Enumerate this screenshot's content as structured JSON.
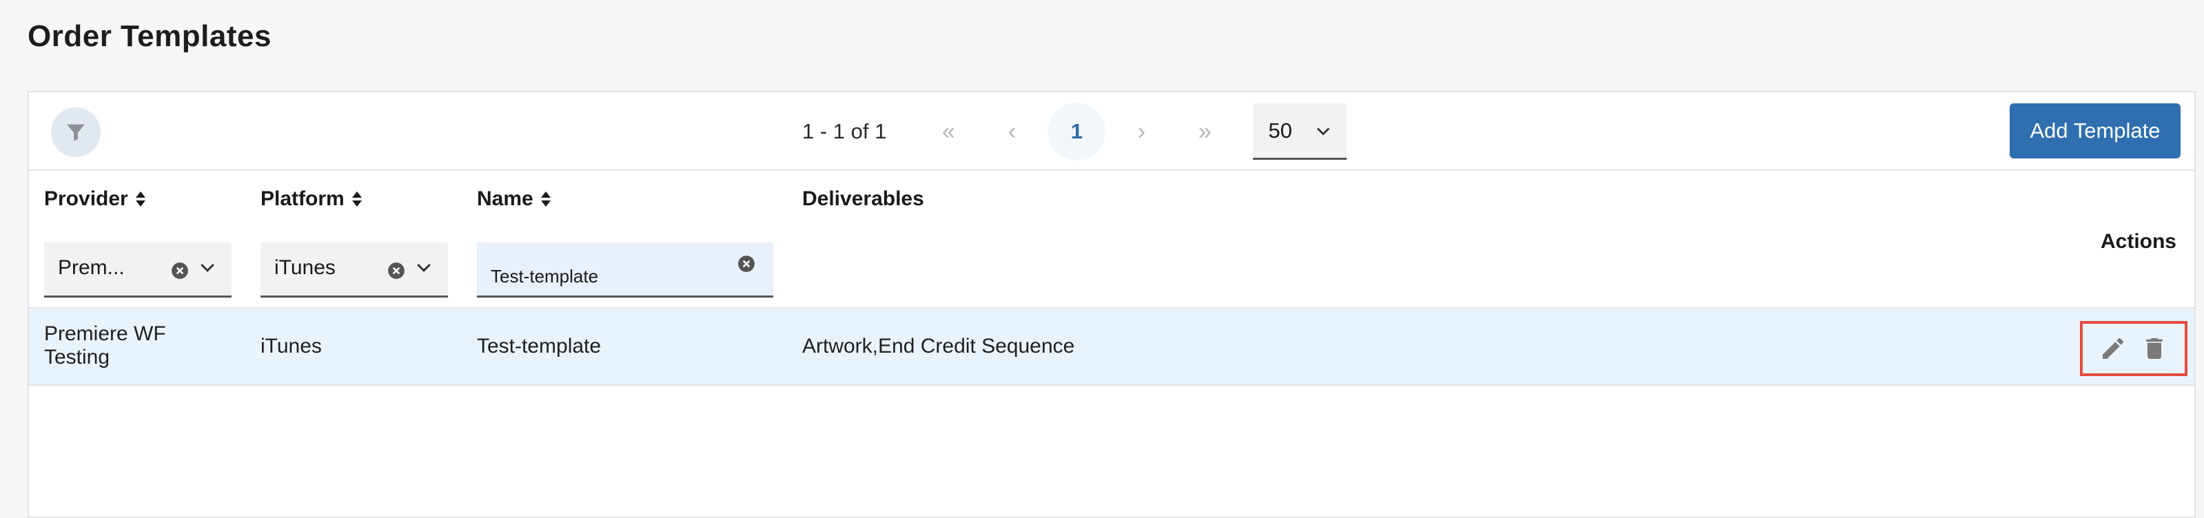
{
  "page": {
    "title": "Order Templates"
  },
  "toolbar": {
    "filter_icon": "filter-icon",
    "range_text": "1 - 1 of 1",
    "first_glyph": "«",
    "prev_glyph": "‹",
    "current_page": "1",
    "next_glyph": "›",
    "last_glyph": "»",
    "page_size": "50",
    "add_label": "Add Template",
    "accent": "#2f6fb0"
  },
  "columns": {
    "provider": "Provider",
    "platform": "Platform",
    "name": "Name",
    "deliverables": "Deliverables",
    "actions": "Actions"
  },
  "filters": {
    "provider_value": "Prem...",
    "platform_value": "iTunes",
    "name_value": "Test-template"
  },
  "rows": [
    {
      "provider": "Premiere WF Testing",
      "platform": "iTunes",
      "name": "Test-template",
      "deliverables": "Artwork,End Credit Sequence",
      "actions": [
        "edit-icon",
        "delete-icon"
      ]
    }
  ],
  "colors": {
    "highlight": "#e34b3e",
    "row_bg": "#e9f3fc"
  }
}
